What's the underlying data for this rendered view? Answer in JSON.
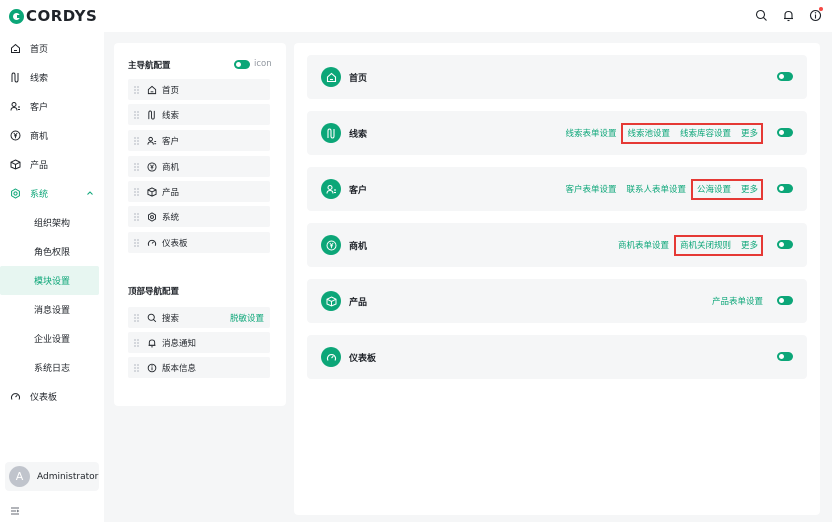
{
  "app": {
    "logo_text": "CORDYS"
  },
  "topbar": {
    "icons": [
      "search-icon",
      "bell-icon",
      "info-icon"
    ]
  },
  "sidebar": {
    "items": [
      {
        "label": "首页",
        "icon": "home-icon"
      },
      {
        "label": "线索",
        "icon": "route-icon"
      },
      {
        "label": "客户",
        "icon": "users-icon"
      },
      {
        "label": "商机",
        "icon": "yuan-icon"
      },
      {
        "label": "产品",
        "icon": "box-icon"
      },
      {
        "label": "系统",
        "icon": "gear-icon"
      }
    ],
    "system_children": [
      "组织架构",
      "角色权限",
      "模块设置",
      "消息设置",
      "企业设置",
      "系统日志"
    ],
    "dashboard": {
      "label": "仪表板",
      "icon": "gauge-icon"
    },
    "user": {
      "avatar_letter": "A",
      "name": "Administrator"
    }
  },
  "config": {
    "main_nav_title": "主导航配置",
    "icon_toggle_label": "icon",
    "main_nav_items": [
      {
        "label": "首页",
        "icon": "home-icon"
      },
      {
        "label": "线索",
        "icon": "route-icon"
      },
      {
        "label": "客户",
        "icon": "users-icon"
      },
      {
        "label": "商机",
        "icon": "yuan-icon"
      },
      {
        "label": "产品",
        "icon": "box-icon"
      },
      {
        "label": "系统",
        "icon": "gear-icon"
      },
      {
        "label": "仪表板",
        "icon": "gauge-icon"
      }
    ],
    "top_nav_title": "顶部导航配置",
    "top_nav_items": [
      {
        "label": "搜索",
        "icon": "search-icon",
        "link": "脱敏设置"
      },
      {
        "label": "消息通知",
        "icon": "bell-icon"
      },
      {
        "label": "版本信息",
        "icon": "info-icon"
      }
    ]
  },
  "modules": [
    {
      "name": "首页",
      "icon": "home-icon",
      "links": [],
      "highlighted": []
    },
    {
      "name": "线索",
      "icon": "route-icon",
      "links": [
        "线索表单设置"
      ],
      "highlighted": [
        "线索池设置",
        "线索库容设置",
        "更多"
      ]
    },
    {
      "name": "客户",
      "icon": "users-icon",
      "links": [
        "客户表单设置",
        "联系人表单设置"
      ],
      "highlighted": [
        "公海设置",
        "更多"
      ]
    },
    {
      "name": "商机",
      "icon": "yuan-icon",
      "links": [
        "商机表单设置"
      ],
      "highlighted": [
        "商机关闭规则",
        "更多"
      ]
    },
    {
      "name": "产品",
      "icon": "box-icon",
      "links": [
        "产品表单设置"
      ],
      "highlighted": []
    },
    {
      "name": "仪表板",
      "icon": "gauge-icon",
      "links": [],
      "highlighted": []
    }
  ],
  "colors": {
    "accent": "#0ca678",
    "highlight_border": "#e53935",
    "selected_bg": "#e7f6f1"
  }
}
